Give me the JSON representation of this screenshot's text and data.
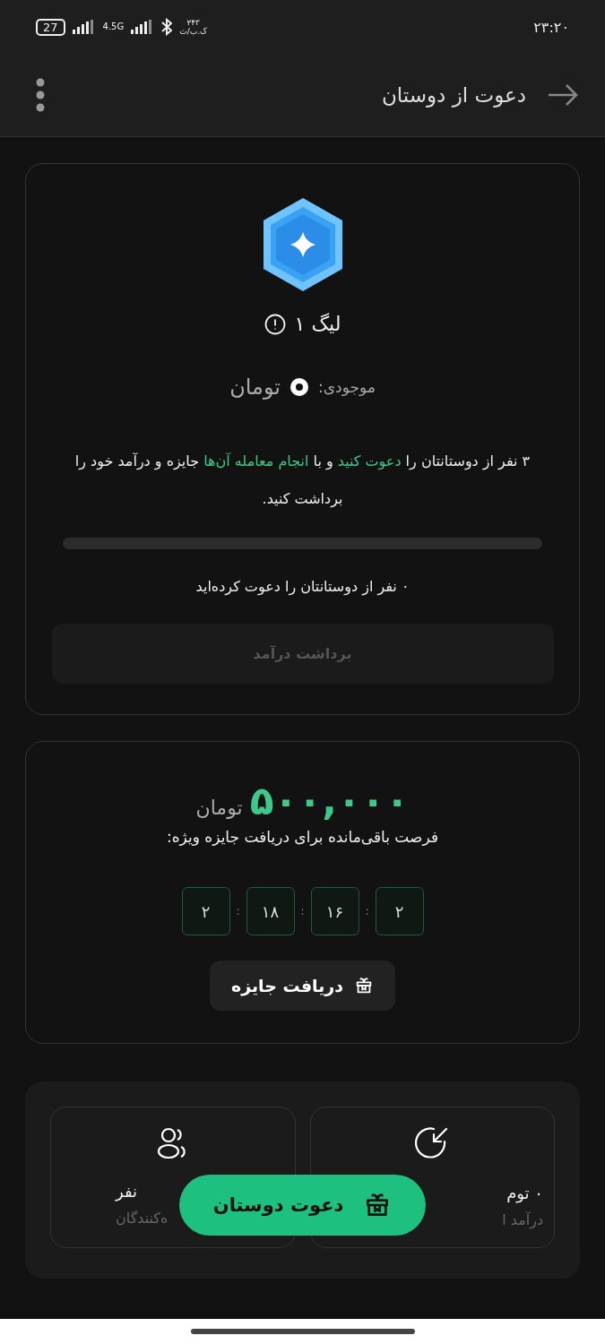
{
  "status_bar": {
    "time": "۲۳:۲۰",
    "battery": "27",
    "network": "4.5G",
    "speed": "۲۴۳",
    "speed_unit": "ک.ب/ث"
  },
  "header": {
    "title": "دعوت از دوستان"
  },
  "league": {
    "title": "لیگ ۱",
    "balance_label": "موجودی:",
    "balance_unit": "تومان",
    "message": [
      {
        "text": "۳ نفر از دوستانتان را ",
        "highlight": false
      },
      {
        "text": "دعوت کنید",
        "highlight": true
      },
      {
        "text": " و با ",
        "highlight": false
      },
      {
        "text": "انجام معامله آن‌ها",
        "highlight": true
      },
      {
        "text": " جایزه و درآمد خود را برداشت کنید.",
        "highlight": false
      }
    ],
    "progress": {
      "level": 0
    },
    "invited_text": "۰ نفر از دوستانتان را دعوت کرده‌اید",
    "withdraw_button": {
      "label": "برداشت درآمد",
      "disabled": true
    }
  },
  "reward": {
    "amount": "۵۰۰,۰۰۰",
    "unit": "تومان",
    "subtitle": "فرصت باقی‌مانده برای دریافت جایزه ویژه:",
    "countdown": {
      "separator": ":",
      "units": [
        "۲",
        "۱۶",
        "۱۸",
        "۲"
      ]
    },
    "claim_button": "دریافت جایزه"
  },
  "stats": [
    {
      "kind": "income",
      "value": "۰ توم",
      "label": "درآمد ا"
    },
    {
      "kind": "people",
      "value": "نفر",
      "label": "ه‌کنندگان"
    }
  ],
  "invite_button": "دعوت دوستان"
}
